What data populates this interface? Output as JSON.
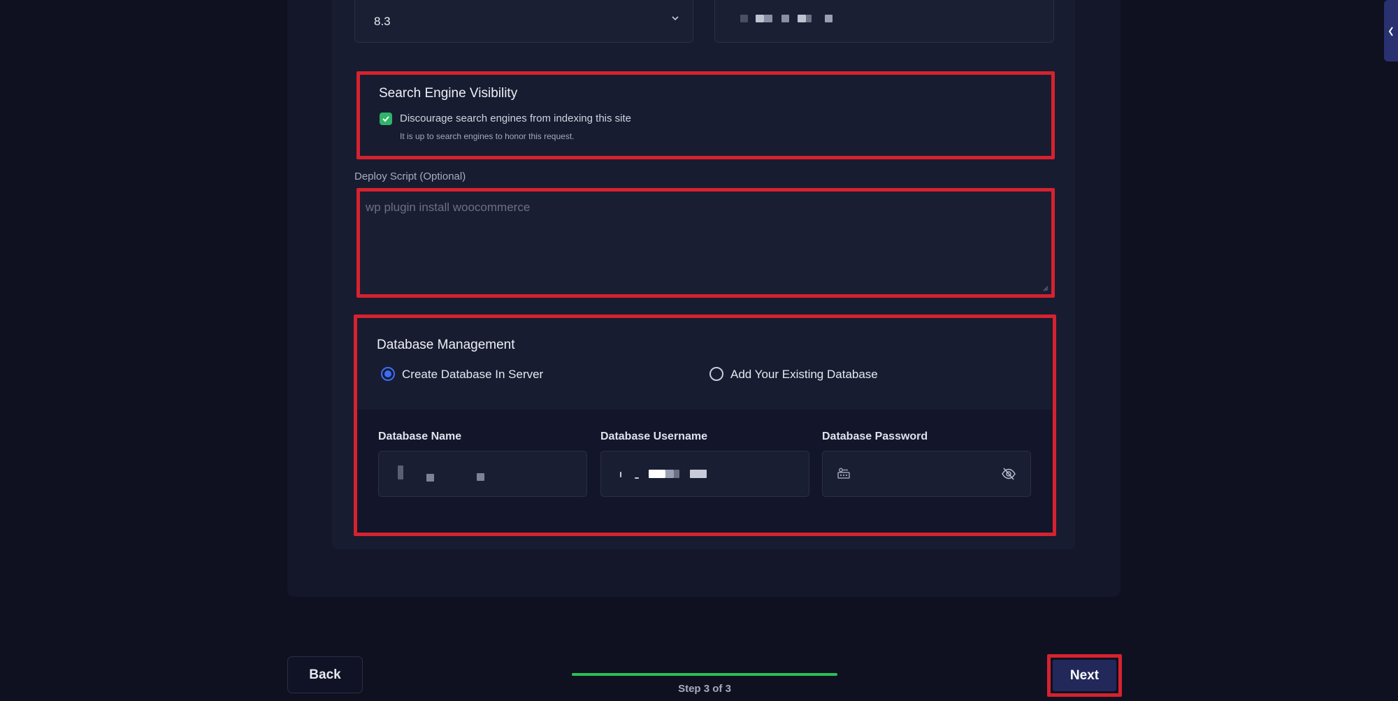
{
  "settings_form": {
    "php_version_value": "8.3",
    "search_engine_visibility": {
      "title": "Search Engine Visibility",
      "checkbox_label": "Discourage search engines from indexing this site",
      "note": "It is up to search engines to honor this request.",
      "checked": true
    },
    "deploy_script": {
      "label": "Deploy Script (Optional)",
      "placeholder": "wp plugin install woocommerce"
    },
    "database_management": {
      "title": "Database Management",
      "options": [
        {
          "label": "Create Database In Server",
          "selected": true
        },
        {
          "label": "Add Your Existing Database",
          "selected": false
        }
      ],
      "fields": {
        "name_label": "Database Name",
        "username_label": "Database Username",
        "password_label": "Database Password"
      }
    }
  },
  "footer": {
    "back_label": "Back",
    "next_label": "Next",
    "step_text": "Step 3 of 3",
    "progress_percent": 100
  },
  "colors": {
    "background": "#0f1121",
    "highlight": "#d6222f",
    "progress": "#2bbf58",
    "radio_active": "#3b6ef5",
    "checkbox": "#2fb46a",
    "next_button": "#22285a"
  }
}
